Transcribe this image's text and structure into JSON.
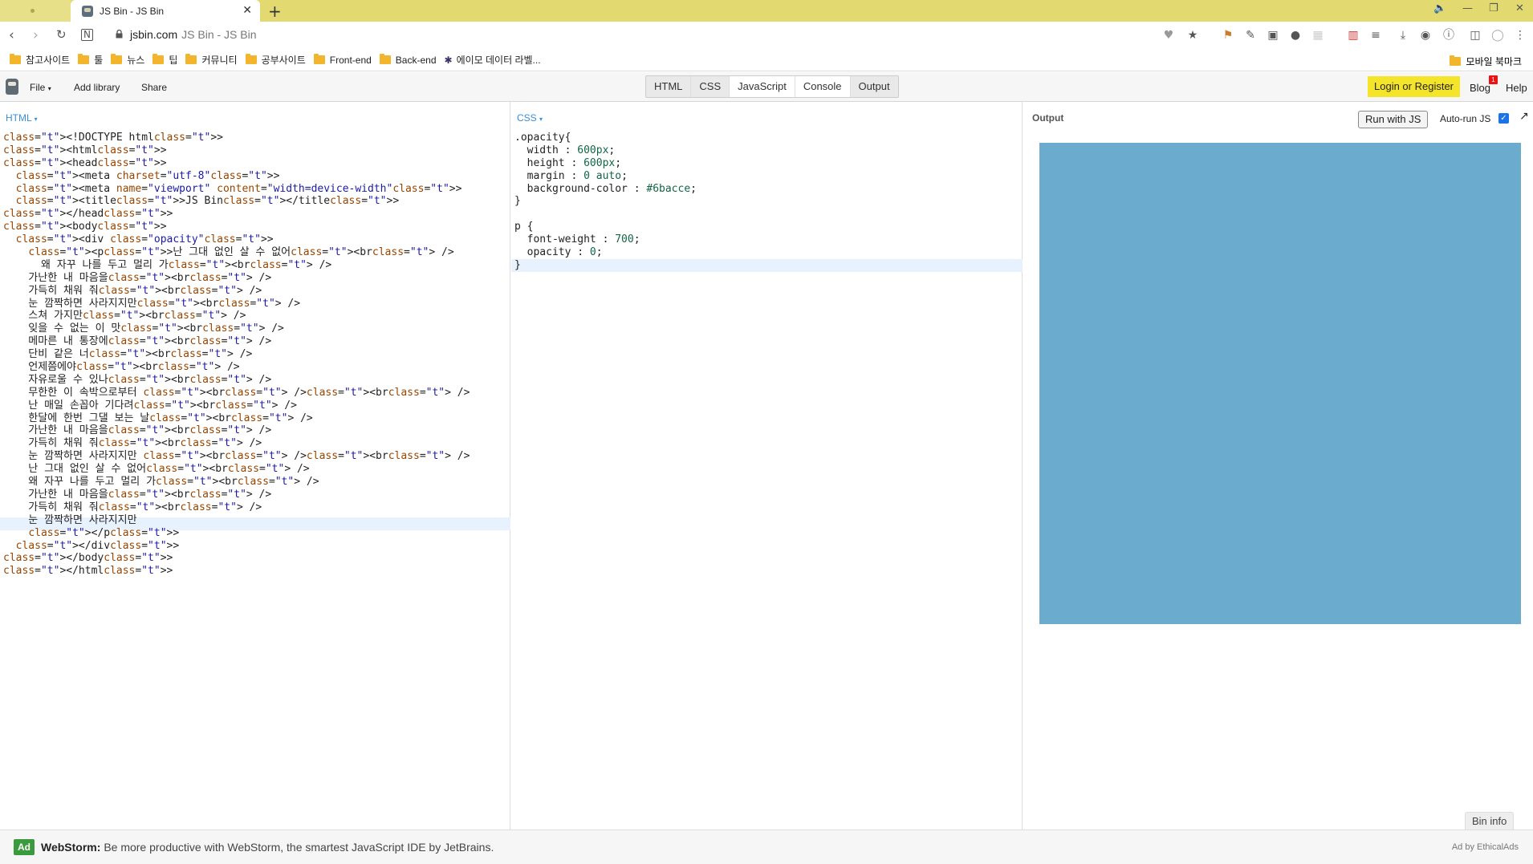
{
  "browser": {
    "tab_title": "JS Bin - JS Bin",
    "tab_close": "✕",
    "new_tab": "+",
    "url_host": "jsbin.com",
    "url_rest": "JS Bin - JS Bin",
    "bookmarks": [
      "참고사이트",
      "툴",
      "뉴스",
      "팁",
      "커뮤니티",
      "공부사이트",
      "Front-end",
      "Back-end",
      "에이모 데이터 라벨..."
    ],
    "mobile_bookmarks": "모바일 북마크"
  },
  "jsbin": {
    "file_menu": "File",
    "add_library": "Add library",
    "share": "Share",
    "panes": [
      "HTML",
      "CSS",
      "JavaScript",
      "Console",
      "Output"
    ],
    "login": "Login or Register",
    "blog": "Blog",
    "blog_badge": "1",
    "help": "Help"
  },
  "html_panel": {
    "label": "HTML",
    "code_lines": [
      "<!DOCTYPE html>",
      "<html>",
      "<head>",
      "  <meta charset=\"utf-8\">",
      "  <meta name=\"viewport\" content=\"width=device-width\">",
      "  <title>JS Bin</title>",
      "</head>",
      "<body>",
      "  <div class=\"opacity\">",
      "    <p>난 그대 없인 살 수 없어<br />",
      "      왜 자꾸 나를 두고 멀리 가<br />",
      "    가난한 내 마음을<br />",
      "    가득히 채워 줘<br />",
      "    눈 깜짝하면 사라지지만<br />",
      "    스쳐 가지만<br />",
      "    잊을 수 없는 이 맛<br />",
      "    메마른 내 통장에<br />",
      "    단비 같은 너<br />",
      "    언제쯤에야<br />",
      "    자유로울 수 있나<br />",
      "    무한한 이 속박으로부터 <br /><br />",
      "    난 매일 손꼽아 기다려<br />",
      "    한달에 한번 그댈 보는 날<br />",
      "    가난한 내 마음을<br />",
      "    가득히 채워 줘<br />",
      "    눈 깜짝하면 사라지지만 <br /><br />",
      "    난 그대 없인 살 수 없어<br />",
      "    왜 자꾸 나를 두고 멀리 가<br />",
      "    가난한 내 마음을<br />",
      "    가득히 채워 줘<br />",
      "    눈 깜짝하면 사라지지만",
      "    </p>",
      "  </div>",
      "</body>",
      "</html>"
    ]
  },
  "css_panel": {
    "label": "CSS",
    "code_lines": [
      ".opacity{",
      "  width : 600px;",
      "  height : 600px;",
      "  margin : 0 auto;",
      "  background-color : #6bacce;",
      "}",
      "",
      "p {",
      "  font-weight : 700;",
      "  opacity : 0;",
      "}"
    ]
  },
  "output_panel": {
    "label": "Output",
    "run_button": "Run with JS",
    "auto_run": "Auto-run JS",
    "auto_run_checked": true,
    "box_color": "#6bacce",
    "bin_info": "Bin info"
  },
  "ad": {
    "tag": "Ad",
    "brand": "WebStorm:",
    "text": "Be more productive with WebStorm, the smartest JavaScript IDE by JetBrains.",
    "by": "Ad by EthicalAds"
  }
}
